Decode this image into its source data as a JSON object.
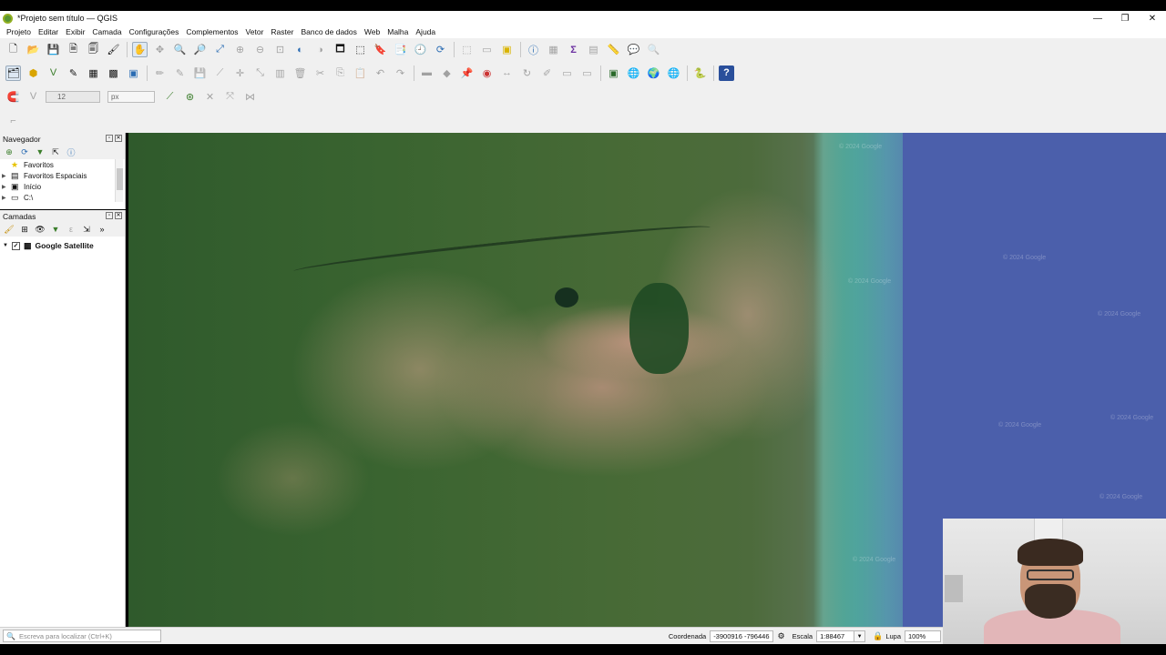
{
  "window": {
    "title": "*Projeto sem título — QGIS",
    "controls": [
      "—",
      "❐",
      "✕"
    ]
  },
  "menu": [
    "Projeto",
    "Editar",
    "Exibir",
    "Camada",
    "Configurações",
    "Complementos",
    "Vetor",
    "Raster",
    "Banco de dados",
    "Web",
    "Malha",
    "Ajuda"
  ],
  "digitizing": {
    "size_value": "12",
    "unit": "px"
  },
  "navigator": {
    "title": "Navegador",
    "items": [
      {
        "label": "Favoritos",
        "icon": "star-icon"
      },
      {
        "label": "Favoritos Espaciais",
        "icon": "spatial-bookmark-icon"
      },
      {
        "label": "Início",
        "icon": "home-icon"
      },
      {
        "label": "C:\\",
        "icon": "drive-icon"
      }
    ]
  },
  "layers": {
    "title": "Camadas",
    "items": [
      {
        "label": "Google Satellite",
        "checked": true
      }
    ]
  },
  "map": {
    "watermarks": [
      "© 2024 Google",
      "© 2024 Google",
      "© 2024 Google",
      "© 2024 Google",
      "© 2024 Google",
      "© 2024 Google",
      "© 2024 Google",
      "© 2024 Google"
    ]
  },
  "status": {
    "locator_placeholder": "Escreva para localizar (Ctrl+K)",
    "coord_label": "Coordenada",
    "coord_value": "-3900916 -796446",
    "scale_label": "Escala",
    "scale_value": "1:88467",
    "magnifier_label": "Lupa",
    "magnifier_value": "100%"
  }
}
